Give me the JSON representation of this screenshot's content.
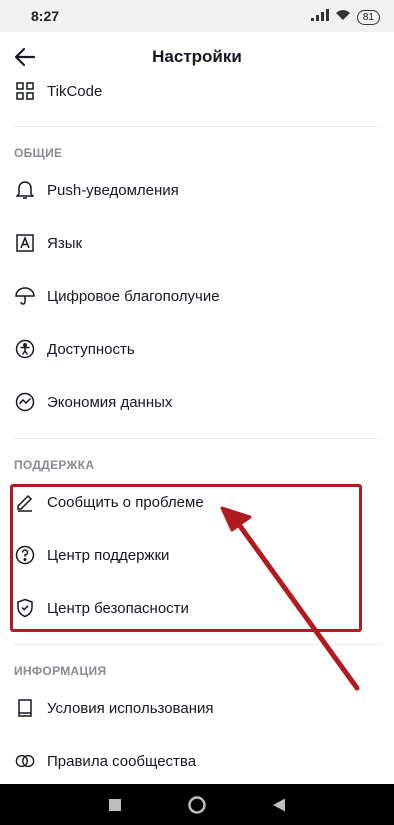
{
  "status_bar": {
    "time": "8:27",
    "battery": "81"
  },
  "header": {
    "title": "Настройки"
  },
  "top_item": {
    "label": "TikCode",
    "icon": "qr-code-icon"
  },
  "sections": {
    "general": {
      "title": "ОБЩИЕ",
      "items": [
        {
          "label": "Push-уведомления",
          "icon": "bell-icon"
        },
        {
          "label": "Язык",
          "icon": "language-icon"
        },
        {
          "label": "Цифровое благополучие",
          "icon": "umbrella-icon"
        },
        {
          "label": "Доступность",
          "icon": "accessibility-icon"
        },
        {
          "label": "Экономия данных",
          "icon": "data-saver-icon"
        }
      ]
    },
    "support": {
      "title": "ПОДДЕРЖКА",
      "items": [
        {
          "label": "Сообщить о проблеме",
          "icon": "pencil-icon"
        },
        {
          "label": "Центр поддержки",
          "icon": "question-icon"
        },
        {
          "label": "Центр безопасности",
          "icon": "shield-icon"
        }
      ]
    },
    "info": {
      "title": "ИНФОРМАЦИЯ",
      "items": [
        {
          "label": "Условия использования",
          "icon": "book-icon"
        },
        {
          "label": "Правила сообщества",
          "icon": "rings-icon"
        }
      ]
    }
  },
  "colors": {
    "annotation": "#b11a1e",
    "text": "#161823",
    "section": "#8a8b91"
  }
}
